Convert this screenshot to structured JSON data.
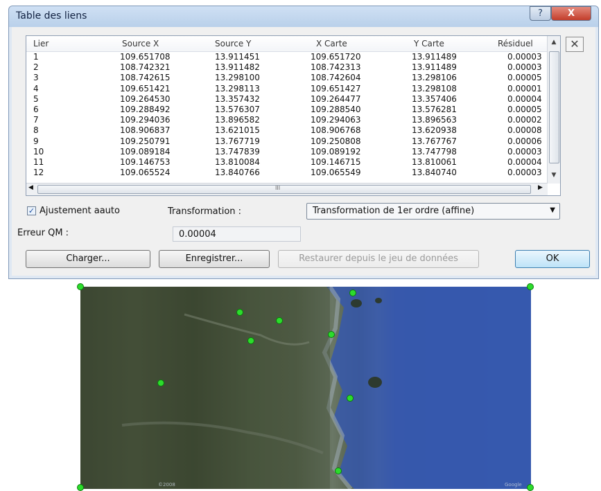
{
  "dialog": {
    "title": "Table des liens",
    "help_glyph": "?",
    "close_glyph": "X",
    "side_close_glyph": "✕"
  },
  "table": {
    "headers": [
      "Lier",
      "Source X",
      "Source Y",
      "X Carte",
      "Y Carte",
      "Résiduel"
    ],
    "rows": [
      [
        "1",
        "109.651708",
        "13.911451",
        "109.651720",
        "13.911489",
        "0.00003"
      ],
      [
        "2",
        "108.742321",
        "13.911482",
        "108.742313",
        "13.911489",
        "0.00003"
      ],
      [
        "3",
        "108.742615",
        "13.298100",
        "108.742604",
        "13.298106",
        "0.00005"
      ],
      [
        "4",
        "109.651421",
        "13.298113",
        "109.651427",
        "13.298108",
        "0.00001"
      ],
      [
        "5",
        "109.264530",
        "13.357432",
        "109.264477",
        "13.357406",
        "0.00004"
      ],
      [
        "6",
        "109.288492",
        "13.576307",
        "109.288540",
        "13.576281",
        "0.00005"
      ],
      [
        "7",
        "109.294036",
        "13.896582",
        "109.294063",
        "13.896563",
        "0.00002"
      ],
      [
        "8",
        "108.906837",
        "13.621015",
        "108.906768",
        "13.620938",
        "0.00008"
      ],
      [
        "9",
        "109.250791",
        "13.767719",
        "109.250808",
        "13.767767",
        "0.00006"
      ],
      [
        "10",
        "109.089184",
        "13.747839",
        "109.089192",
        "13.747798",
        "0.00003"
      ],
      [
        "11",
        "109.146753",
        "13.810084",
        "109.146715",
        "13.810061",
        "0.00004"
      ],
      [
        "12",
        "109.065524",
        "13.840766",
        "109.065549",
        "13.840740",
        "0.00003"
      ]
    ],
    "hscroll_grip": "III"
  },
  "options": {
    "auto_adjust_label": "Ajustement aauto",
    "auto_adjust_checked": true,
    "transformation_label": "Transformation :",
    "transformation_value": "Transformation de 1er ordre (affine)",
    "rms_label": "Erreur QM :",
    "rms_value": "0.00004"
  },
  "buttons": {
    "load": "Charger...",
    "save": "Enregistrer...",
    "restore": "Restaurer depuis le jeu de données",
    "ok": "OK"
  },
  "colors": {
    "gcp_marker": "#2cdc2c",
    "sea": "#3658ad",
    "land": "#46513a"
  }
}
